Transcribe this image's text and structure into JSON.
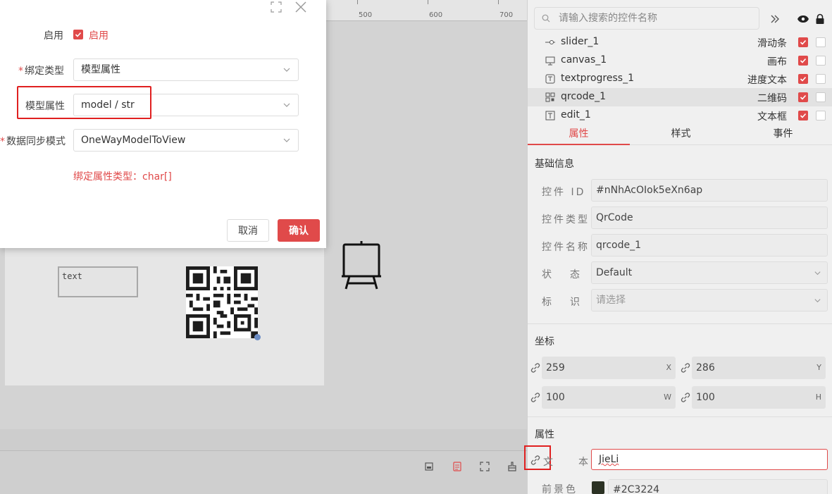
{
  "modal": {
    "enable_label": "启用",
    "enable_checkbox_text": "启用",
    "binding_type_label": "绑定类型",
    "binding_type_value": "模型属性",
    "model_property_label": "模型属性",
    "model_property_value": "model / str",
    "sync_mode_label": "数据同步模式",
    "sync_mode_value": "OneWayModelToView",
    "hint": "绑定属性类型：char[]",
    "cancel_label": "取消",
    "ok_label": "确认",
    "required_mark": "*"
  },
  "ruler": {
    "ticks": [
      "500",
      "600",
      "700"
    ]
  },
  "canvas": {
    "text_widget_text": "text"
  },
  "right_panel": {
    "search_placeholder": "请输入搜索的控件名称",
    "widgets": [
      {
        "name": "slider_1",
        "type": "滑动条",
        "icon": "slider-icon",
        "visible": true
      },
      {
        "name": "canvas_1",
        "type": "画布",
        "icon": "canvas-icon",
        "visible": true
      },
      {
        "name": "textprogress_1",
        "type": "进度文本",
        "icon": "textprogress-icon",
        "visible": true
      },
      {
        "name": "qrcode_1",
        "type": "二维码",
        "icon": "qrcode-icon",
        "visible": true,
        "selected": true
      },
      {
        "name": "edit_1",
        "type": "文本框",
        "icon": "edit-icon",
        "visible": true
      }
    ],
    "tabs": [
      "属性",
      "样式",
      "事件"
    ],
    "active_tab": "属性",
    "basic_info_title": "基础信息",
    "basic_info": {
      "id_label": "控件 ID",
      "id_value": "#nNhAcOIok5eXn6ap",
      "type_label": "控件类型",
      "type_value": "QrCode",
      "name_label": "控件名称",
      "name_value": "qrcode_1",
      "state_label": "状态",
      "state_value": "Default",
      "tag_label": "标识",
      "tag_placeholder": "请选择"
    },
    "coords_title": "坐标",
    "coords": {
      "x": "259",
      "x_axis": "X",
      "y": "286",
      "y_axis": "Y",
      "w": "100",
      "w_axis": "W",
      "h": "100",
      "h_axis": "H"
    },
    "props_title": "属性",
    "props": {
      "text_label": "文本",
      "text_value": "JieLi",
      "fg_label": "前景色",
      "fg_value": "#2C3224"
    }
  },
  "colors": {
    "accent": "#e04a4a",
    "foreground": "#2C3224"
  }
}
